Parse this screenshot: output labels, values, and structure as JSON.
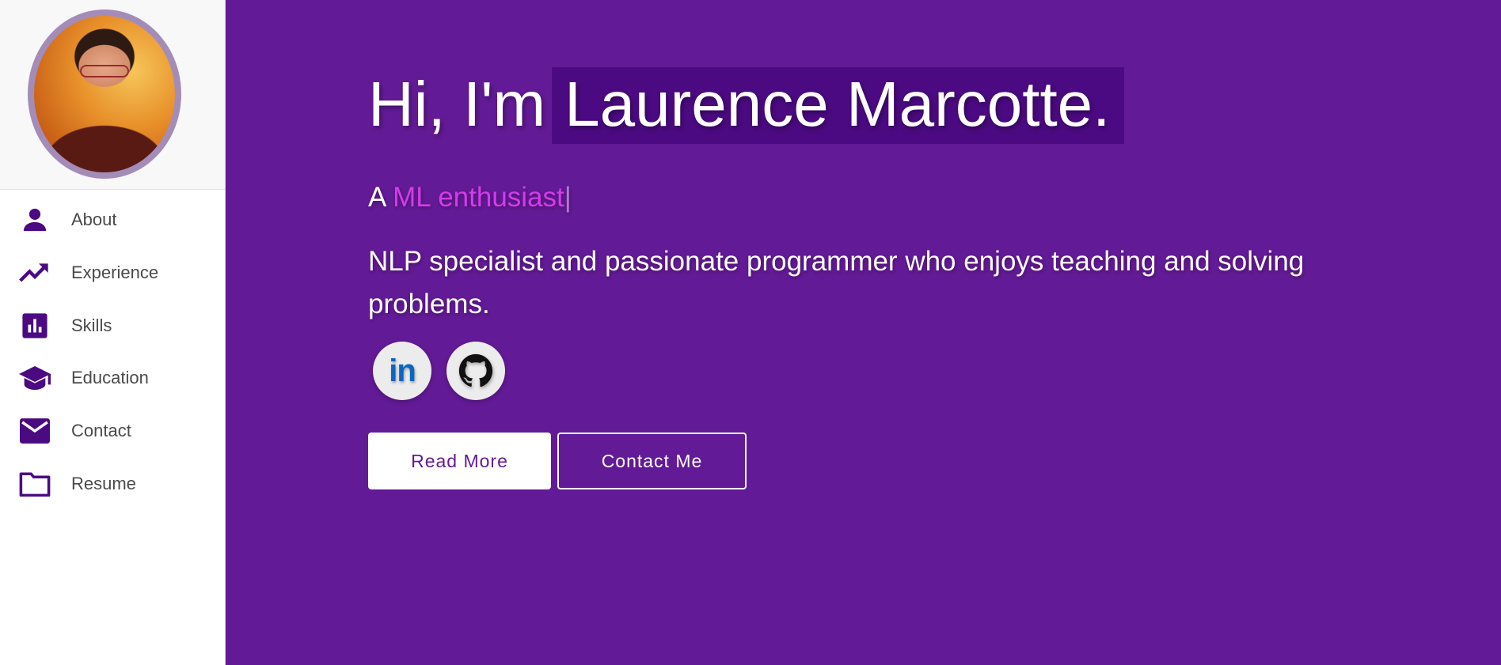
{
  "sidebar": {
    "profile_photo": "profile-photo",
    "items": [
      {
        "label": "About",
        "icon": "person-icon"
      },
      {
        "label": "Experience",
        "icon": "trending-up-icon"
      },
      {
        "label": "Skills",
        "icon": "bar-chart-icon"
      },
      {
        "label": "Education",
        "icon": "graduation-cap-icon"
      },
      {
        "label": "Contact",
        "icon": "mail-icon"
      },
      {
        "label": "Resume",
        "icon": "folder-icon"
      }
    ]
  },
  "hero": {
    "greeting": "Hi, I'm",
    "name": "Laurence Marcotte.",
    "subtitle_prefix": "A",
    "subtitle_typed": "ML enthusiast",
    "cursor": "|",
    "description": "NLP specialist and passionate programmer who enjoys teaching and solving problems.",
    "social": [
      {
        "name": "LinkedIn",
        "icon": "linkedin-icon",
        "glyph": "in"
      },
      {
        "name": "GitHub",
        "icon": "github-icon"
      }
    ],
    "buttons": {
      "read_more": "Read More",
      "contact_me": "Contact Me"
    }
  },
  "colors": {
    "primary": "#631a96",
    "name_highlight": "#4b0a82",
    "accent": "#d43ce8",
    "nav_icon": "#4b0a82",
    "nav_text": "#4a4a4a",
    "avatar_border": "#a48cb8"
  }
}
